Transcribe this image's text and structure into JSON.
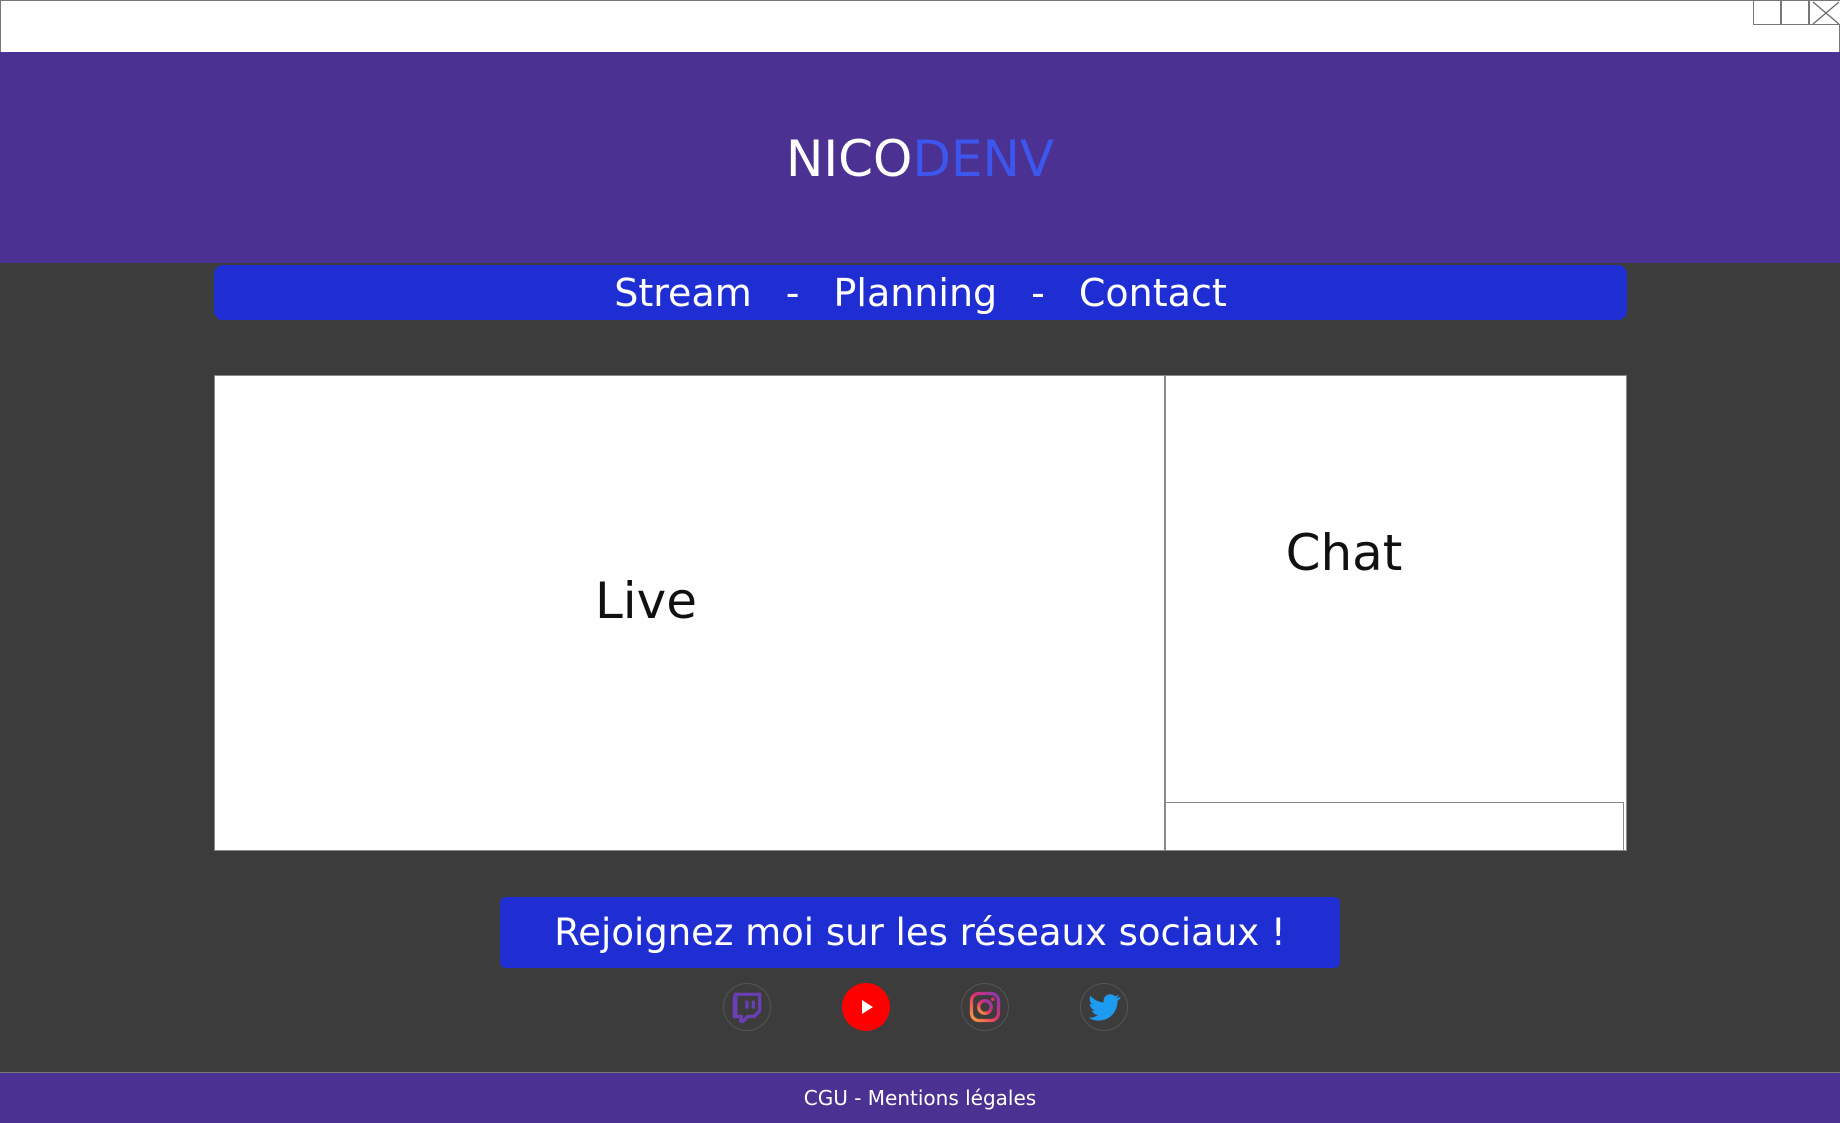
{
  "window": {
    "icons": [
      "minimize-icon",
      "maximize-icon",
      "close-icon"
    ]
  },
  "header": {
    "logo_part1": "NICO",
    "logo_part2": "DENV",
    "colors": {
      "background": "#4b3191",
      "logo_accent": "#3d56ee"
    }
  },
  "nav": {
    "items": [
      {
        "label": "Stream"
      },
      {
        "label": "Planning"
      },
      {
        "label": "Contact"
      }
    ],
    "separator": "-",
    "color": "#1f2ed3"
  },
  "main": {
    "live_label": "Live",
    "chat_label": "Chat"
  },
  "social": {
    "banner": "Rejoignez moi sur les réseaux sociaux !",
    "icons": [
      "twitch-icon",
      "youtube-icon",
      "instagram-icon",
      "twitter-icon"
    ]
  },
  "footer": {
    "text": "CGU - Mentions légales"
  },
  "colors": {
    "page_background": "#3c3c3c"
  }
}
